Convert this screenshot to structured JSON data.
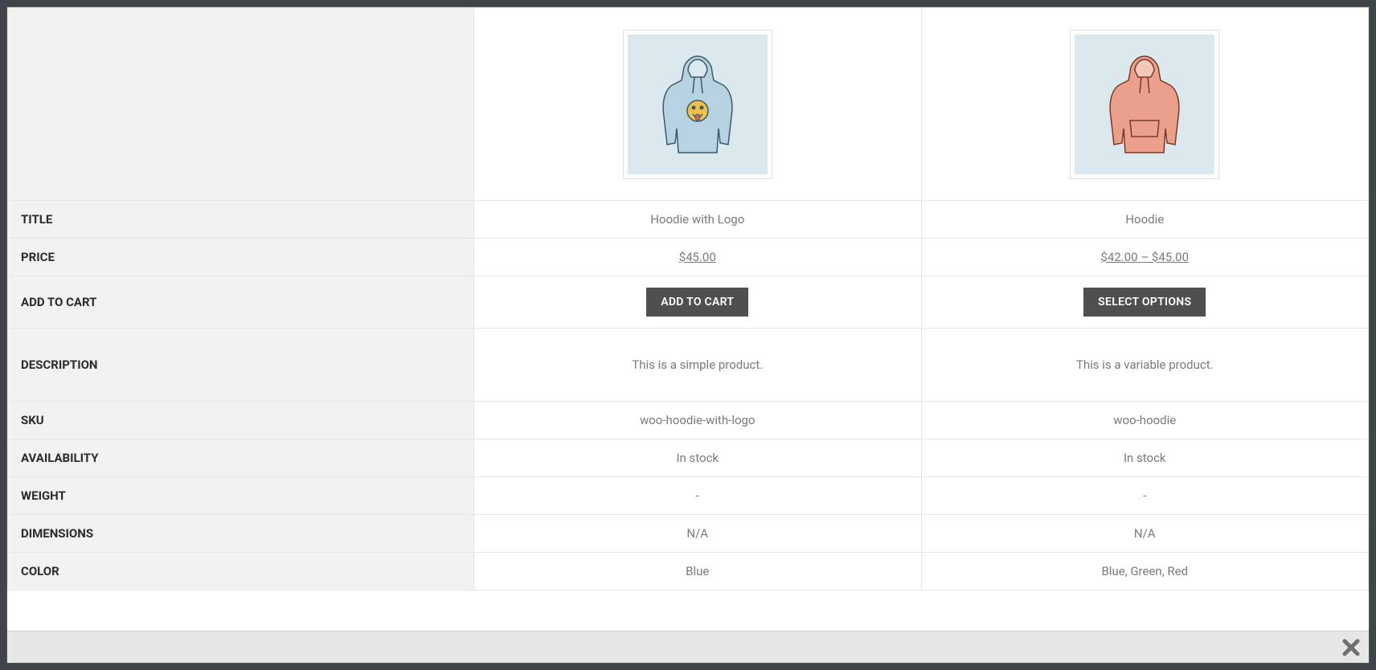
{
  "rows": {
    "title": "TITLE",
    "price": "PRICE",
    "add_to_cart": "ADD TO CART",
    "description": "DESCRIPTION",
    "sku": "SKU",
    "availability": "AVAILABILITY",
    "weight": "WEIGHT",
    "dimensions": "DIMENSIONS",
    "color": "COLOR"
  },
  "products": [
    {
      "title": "Hoodie with Logo",
      "price": "$45.00",
      "cart_button": "ADD TO CART",
      "description": "This is a simple product.",
      "sku": "woo-hoodie-with-logo",
      "availability": "In stock",
      "weight": "-",
      "dimensions": "N/A",
      "color": "Blue",
      "image_icon": "hoodie-blue-logo"
    },
    {
      "title": "Hoodie",
      "price": "$42.00 – $45.00",
      "cart_button": "SELECT OPTIONS",
      "description": "This is a variable product.",
      "sku": "woo-hoodie",
      "availability": "In stock",
      "weight": "-",
      "dimensions": "N/A",
      "color": "Blue, Green, Red",
      "image_icon": "hoodie-red"
    }
  ]
}
